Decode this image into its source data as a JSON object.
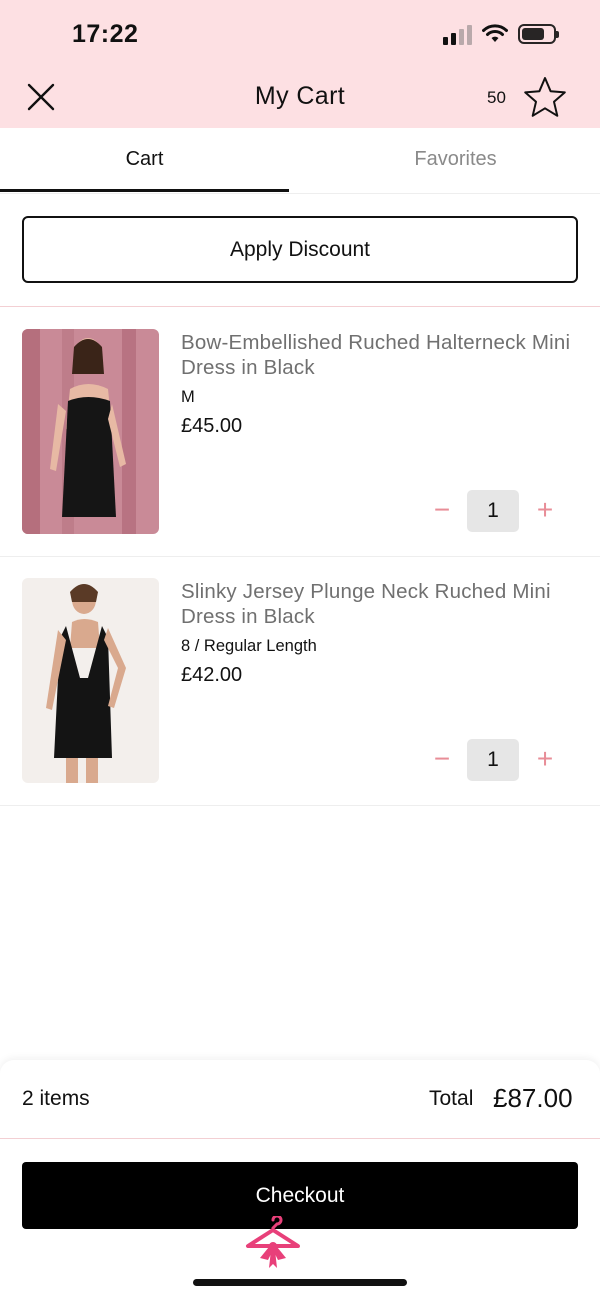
{
  "status_bar": {
    "time": "17:22",
    "icons": [
      "signal-icon",
      "wifi-icon",
      "battery-icon"
    ]
  },
  "header": {
    "title": "My Cart",
    "favorites_count": "50",
    "close_icon": "close-icon",
    "favorites_icon": "star-icon",
    "background": "#fde0e3"
  },
  "tabs": [
    {
      "label": "Cart",
      "active": true
    },
    {
      "label": "Favorites",
      "active": false
    }
  ],
  "discount": {
    "label": "Apply Discount"
  },
  "cart": {
    "items": [
      {
        "name": "Bow-Embellished Ruched Halterneck Mini Dress in Black",
        "variant": "M",
        "price": "£45.00",
        "quantity": "1",
        "minus": "−",
        "plus": "+"
      },
      {
        "name": "Slinky Jersey Plunge Neck Ruched Mini Dress in Black",
        "variant": "8 / Regular Length",
        "price": "£42.00",
        "quantity": "1",
        "minus": "−",
        "plus": "+"
      }
    ]
  },
  "summary": {
    "items_count": "2 items",
    "total_label": "Total",
    "total_value": "£87.00"
  },
  "checkout": {
    "label": "Checkout",
    "background": "#000000"
  },
  "brand": {
    "logo_icon": "hanger-bow-icon",
    "accent": "#e8407a"
  },
  "colors": {
    "qty_buttons": "#e88d97",
    "divider": "#f3cfd3"
  }
}
